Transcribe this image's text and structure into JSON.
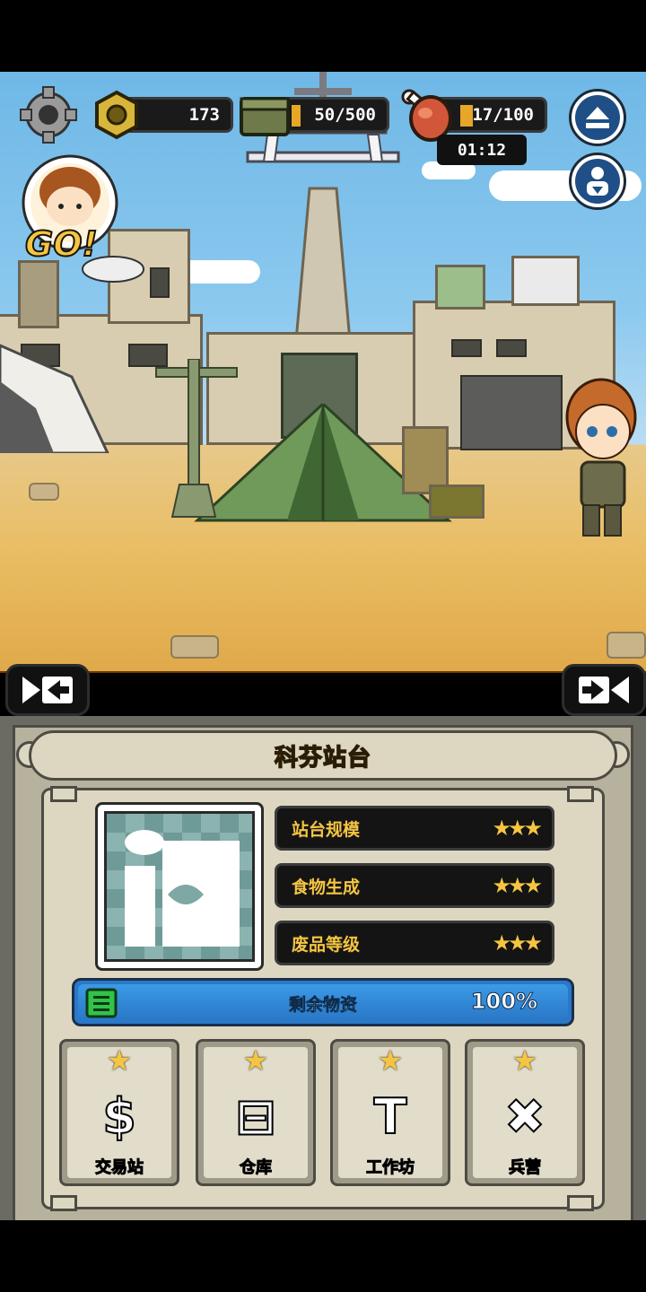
{
  "hud": {
    "scrap": {
      "value": "173",
      "icon": "hex-nut-icon"
    },
    "ammo": {
      "value": "50/500",
      "level": 0.1,
      "icon": "ammo-crate-icon"
    },
    "food": {
      "value": "17/100",
      "level": 0.17,
      "icon": "meat-icon",
      "timer": "01:12"
    }
  },
  "go_badge": {
    "text": "GO!"
  },
  "panel": {
    "title": "科芬站台",
    "stats": [
      {
        "label": "站台规模",
        "stars": "★★★"
      },
      {
        "label": "食物生成",
        "stars": "★★★"
      },
      {
        "label": "废品等级",
        "stars": "★★★"
      }
    ],
    "supply": {
      "label": "剩余物资",
      "value": "100%",
      "level": 1.0
    },
    "facilities": [
      {
        "label": "交易站",
        "icon": "money-bag-icon",
        "glyph": "$"
      },
      {
        "label": "仓库",
        "icon": "warehouse-icon",
        "glyph": "⊟"
      },
      {
        "label": "工作坊",
        "icon": "hammer-icon",
        "glyph": "T"
      },
      {
        "label": "兵营",
        "icon": "crossed-swords-icon",
        "glyph": "✖"
      }
    ]
  },
  "colors": {
    "accent": "#f5c542",
    "supply_bar": "#2a78c8",
    "ground_band": "#b5651d"
  }
}
